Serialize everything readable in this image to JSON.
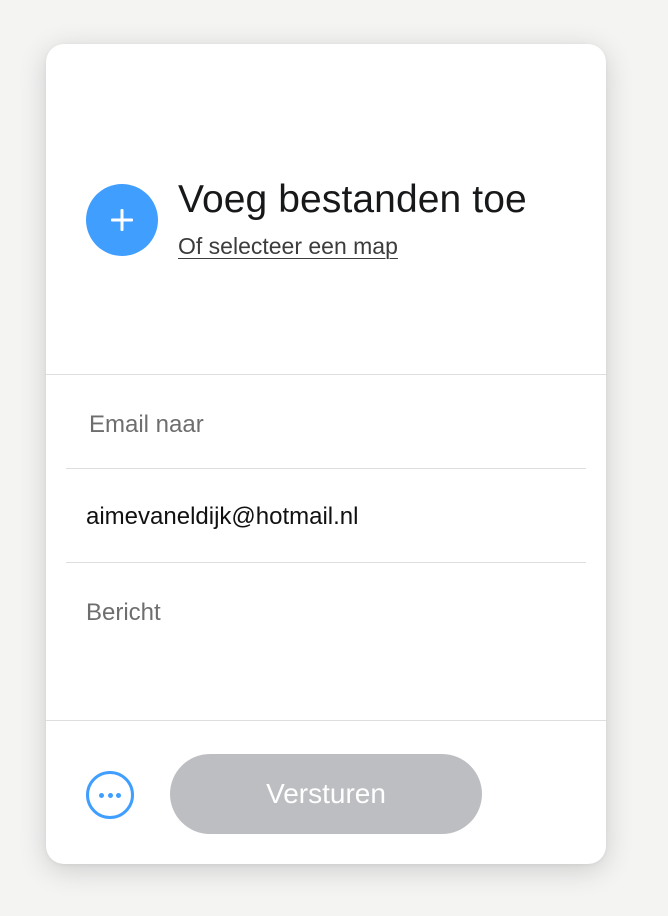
{
  "upload": {
    "title": "Voeg bestanden toe",
    "select_folder_link": "Of selecteer een map",
    "add_icon": "plus-icon"
  },
  "form": {
    "email_to_placeholder": "Email naar",
    "email_value": "aimevaneldijk@hotmail.nl",
    "message_placeholder": "Bericht"
  },
  "footer": {
    "more_icon": "more-options-icon",
    "send_label": "Versturen"
  },
  "colors": {
    "accent": "#409eff",
    "send_disabled": "#bdbec2",
    "background": "#f4f4f3"
  }
}
